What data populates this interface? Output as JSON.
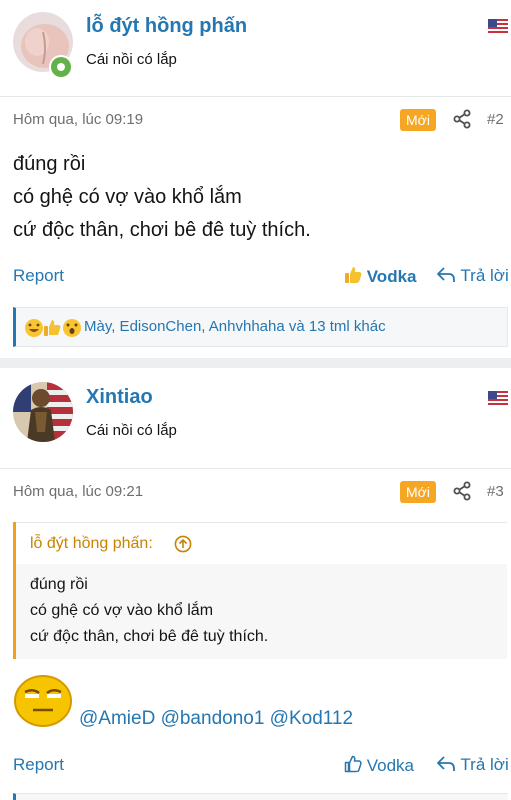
{
  "posts": [
    {
      "username": "lỗ đýt hồng phấn",
      "usertitle": "Cái nồi có lắp",
      "time": "Hôm qua, lúc 09:19",
      "badge": "Mới",
      "post_num": "#2",
      "lines": [
        "đúng rồi",
        "có ghệ có vợ vào khổ lắm",
        "cứ độc thân, chơi bê đê tuỳ thích."
      ],
      "report": "Report",
      "like": "Vodka",
      "reply": "Trả lời",
      "reactions_text": "Mày, EdisonChen, Anhvhhaha và 13 tml khác"
    },
    {
      "username": "Xintiao",
      "usertitle": "Cái nồi có lắp",
      "time": "Hôm qua, lúc 09:21",
      "badge": "Mới",
      "post_num": "#3",
      "quote_author": "lỗ đýt hồng phấn:",
      "quote_lines": [
        "đúng rồi",
        "có ghệ có vợ vào khổ lắm",
        "cứ độc thân, chơi bê đê tuỳ thích."
      ],
      "mentions": "@AmieD @bandono1 @Kod112",
      "report": "Report",
      "like": "Vodka",
      "reply": "Trả lời"
    }
  ],
  "colors": {
    "link": "#2577b1",
    "badge": "#f5a623",
    "online": "#63b149",
    "quote_accent": "#f29f1b"
  }
}
